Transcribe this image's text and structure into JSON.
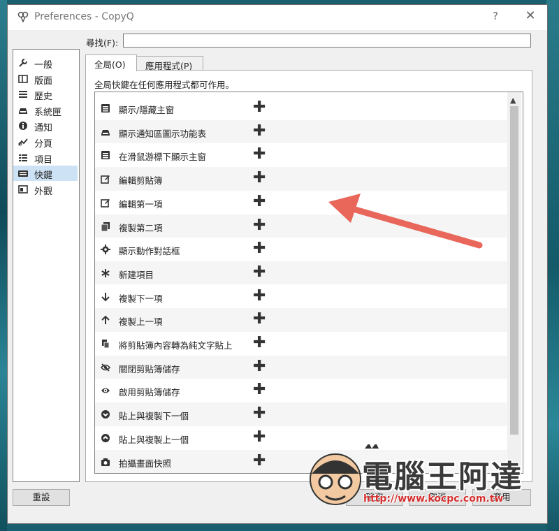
{
  "window": {
    "title": "Preferences - CopyQ",
    "help": "?",
    "close": "✕"
  },
  "search": {
    "label": "尋找(F):",
    "value": ""
  },
  "sidebar": {
    "items": [
      {
        "label": "一般",
        "icon": "wrench-icon"
      },
      {
        "label": "版面",
        "icon": "layout-icon"
      },
      {
        "label": "歷史",
        "icon": "list-icon"
      },
      {
        "label": "系統匣",
        "icon": "tray-icon"
      },
      {
        "label": "通知",
        "icon": "info-icon"
      },
      {
        "label": "分頁",
        "icon": "tabs-icon"
      },
      {
        "label": "項目",
        "icon": "items-icon"
      },
      {
        "label": "快鍵",
        "icon": "keyboard-icon"
      },
      {
        "label": "外觀",
        "icon": "appearance-icon"
      }
    ],
    "selected": 7
  },
  "tabs": [
    {
      "label": "全局(O)"
    },
    {
      "label": "應用程式(P)"
    }
  ],
  "panel": {
    "description": "全局快鍵在任何應用程式都可作用。"
  },
  "shortcuts": [
    {
      "label": "顯示/隱藏主窗",
      "icon": "window-icon"
    },
    {
      "label": "顯示通知區圖示功能表",
      "icon": "tray-icon"
    },
    {
      "label": "在滑鼠游標下顯示主窗",
      "icon": "window-icon"
    },
    {
      "label": "編輯剪貼簿",
      "icon": "edit-icon"
    },
    {
      "label": "編輯第一項",
      "icon": "edit-icon"
    },
    {
      "label": "複製第二項",
      "icon": "copy-icon"
    },
    {
      "label": "顯示動作對話框",
      "icon": "gear-icon"
    },
    {
      "label": "新建項目",
      "icon": "asterisk-icon"
    },
    {
      "label": "複製下一項",
      "icon": "arrow-down-icon"
    },
    {
      "label": "複製上一項",
      "icon": "arrow-up-icon"
    },
    {
      "label": "將剪貼簿內容轉為純文字貼上",
      "icon": "paste-icon"
    },
    {
      "label": "關閉剪貼簿儲存",
      "icon": "eye-slash-icon"
    },
    {
      "label": "啟用剪貼簿儲存",
      "icon": "eye-icon"
    },
    {
      "label": "貼上與複製下一個",
      "icon": "circle-down-icon"
    },
    {
      "label": "貼上與複製上一個",
      "icon": "circle-up-icon"
    },
    {
      "label": "拍攝畫面快照",
      "icon": "camera-icon"
    }
  ],
  "add_glyph": "✚",
  "buttons": {
    "reset": "重設",
    "ok": "確定",
    "cancel": "取消",
    "apply": "套用"
  },
  "watermark": {
    "text": "電腦王阿達",
    "url": "http://www.kocpc.com.tw"
  },
  "colors": {
    "arrow": "#e8665a",
    "selection": "#cde3f5"
  }
}
